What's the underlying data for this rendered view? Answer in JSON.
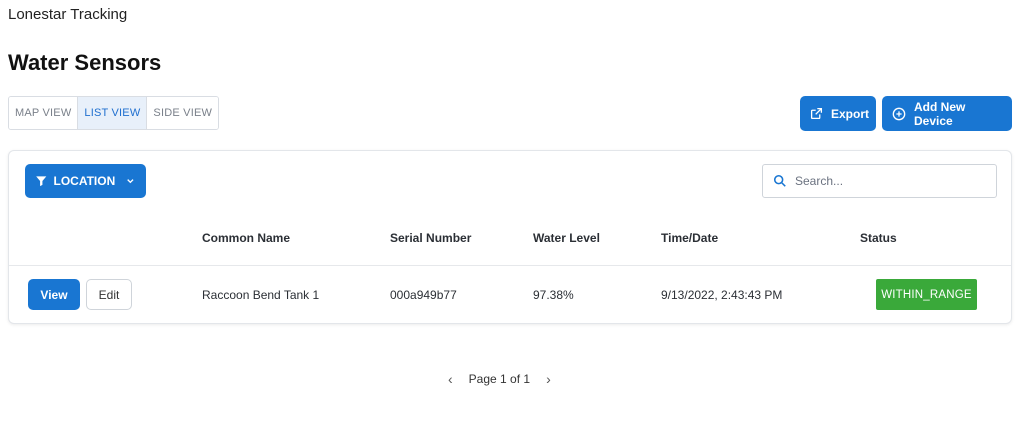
{
  "app": {
    "title": "Lonestar Tracking"
  },
  "page": {
    "title": "Water Sensors"
  },
  "view_tabs": [
    {
      "label": "MAP VIEW",
      "active": false
    },
    {
      "label": "LIST VIEW",
      "active": true
    },
    {
      "label": "SIDE VIEW",
      "active": false
    }
  ],
  "toolbar": {
    "export_label": "Export",
    "add_label": "Add New Device"
  },
  "filter": {
    "label": "LOCATION"
  },
  "search": {
    "placeholder": "Search...",
    "value": ""
  },
  "table": {
    "columns": [
      "Common Name",
      "Serial Number",
      "Water Level",
      "Time/Date",
      "Status"
    ],
    "rows": [
      {
        "view_label": "View",
        "edit_label": "Edit",
        "common_name": "Raccoon Bend Tank 1",
        "serial_number": "000a949b77",
        "water_level": "97.38%",
        "time_date": "9/13/2022, 2:43:43 PM",
        "status": "WITHIN_RANGE"
      }
    ]
  },
  "pagination": {
    "label": "Page 1 of 1"
  },
  "colors": {
    "primary": "#1976d2",
    "status_ok": "#3aa93a"
  }
}
